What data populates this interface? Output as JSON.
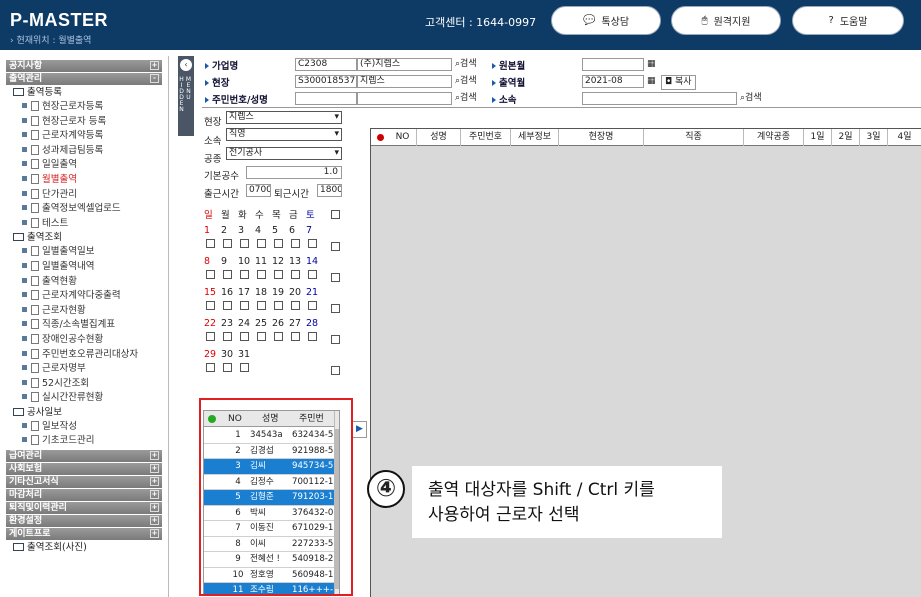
{
  "header": {
    "logo": "P-MASTER",
    "location": "› 현재위치 : 월별출역",
    "support": "고객센터 : 1644-0997",
    "btn_chat": "톡상담",
    "btn_remote": "원격지원",
    "btn_help": "도움말"
  },
  "sidebar": {
    "sections_top": [
      "공지사항",
      "출역관리"
    ],
    "group1": "출역등록",
    "items1": [
      "현장근로자등록",
      "현장근로자 등록",
      "근로자계약등록",
      "성과제급팀등록",
      "일일출역",
      "월별출역",
      "단가관리",
      "출역정보엑셀업로드",
      "테스트"
    ],
    "group2": "출역조회",
    "items2": [
      "일별출역일보",
      "일별출역내역",
      "출역현황",
      "근로자계약다중출력",
      "근로자현황",
      "직종/소속별집계표",
      "장애인공수현황",
      "주민번호오류관리대상자",
      "근로자명부",
      "52시간조회",
      "실시간잔류현황"
    ],
    "group3": "공사일보",
    "items3": [
      "일보작성",
      "기초코드관리"
    ],
    "sections_bottom": [
      "급여관리",
      "사회보험",
      "기타신고서식",
      "마감처리",
      "퇴직및이력관리",
      "환경설정",
      "게이트프로"
    ],
    "last_item": "출역조회(사진)",
    "menu_hidden": "MENU HIDDEN"
  },
  "search": {
    "company_label": "가업명",
    "company_code": "C2308",
    "company_name": "(주)지렙스",
    "site_label": "현장",
    "site_code": "S300018537",
    "site_name": "지렙스",
    "id_label": "주민번호/성명",
    "search_btn": "검색",
    "origin_label": "원본월",
    "origin_value": "",
    "month_label": "출역월",
    "month_value": "2021-08",
    "copy_btn": "복사",
    "affil_label": "소속"
  },
  "form": {
    "site_label": "현장",
    "site_value": "지렙스",
    "affil_label": "소속",
    "affil_value": "직영",
    "trade_label": "공종",
    "trade_value": "전기공사",
    "base_label": "기본공수",
    "base_value": "1.0",
    "in_label": "출근시간",
    "in_value": "0700",
    "out_label": "퇴근시간",
    "out_value": "1800"
  },
  "calendar": {
    "days": [
      "일",
      "월",
      "화",
      "수",
      "목",
      "금",
      "토"
    ],
    "weeks": [
      [
        "1",
        "2",
        "3",
        "4",
        "5",
        "6",
        "7"
      ],
      [
        "8",
        "9",
        "10",
        "11",
        "12",
        "13",
        "14"
      ],
      [
        "15",
        "16",
        "17",
        "18",
        "19",
        "20",
        "21"
      ],
      [
        "22",
        "23",
        "24",
        "25",
        "26",
        "27",
        "28"
      ],
      [
        "29",
        "30",
        "31",
        "",
        "",
        "",
        ""
      ]
    ]
  },
  "workers": {
    "headers": [
      "NO",
      "성명",
      "주민번"
    ],
    "rows": [
      [
        "1",
        "34543a",
        "632434-5"
      ],
      [
        "2",
        "김경섭",
        "921988-5"
      ],
      [
        "3",
        "김씨",
        "945734-5"
      ],
      [
        "4",
        "김정수",
        "700112-1"
      ],
      [
        "5",
        "김형준",
        "791203-1"
      ],
      [
        "6",
        "박씨",
        "376432-0"
      ],
      [
        "7",
        "이동진",
        "671029-1"
      ],
      [
        "8",
        "이씨",
        "227233-5"
      ],
      [
        "9",
        "전혜선 !",
        "540918-2"
      ],
      [
        "10",
        "정호영",
        "560948-1"
      ],
      [
        "11",
        "조수림",
        "116+++-"
      ]
    ],
    "selected": [
      3,
      5,
      11
    ]
  },
  "grid": {
    "headers": [
      "NO",
      "성명",
      "주민번호",
      "세부정보",
      "현장명",
      "직종",
      "계약공종",
      "1일",
      "2일",
      "3일",
      "4일"
    ]
  },
  "annotation": {
    "number": "④",
    "line1": "출역 대상자를 Shift / Ctrl 키를",
    "line2": "사용하여 근로자 선택"
  },
  "colors": {
    "header_bg": "#0e3a66",
    "selected_row": "#1a7fd0",
    "highlight_border": "#e02020"
  }
}
